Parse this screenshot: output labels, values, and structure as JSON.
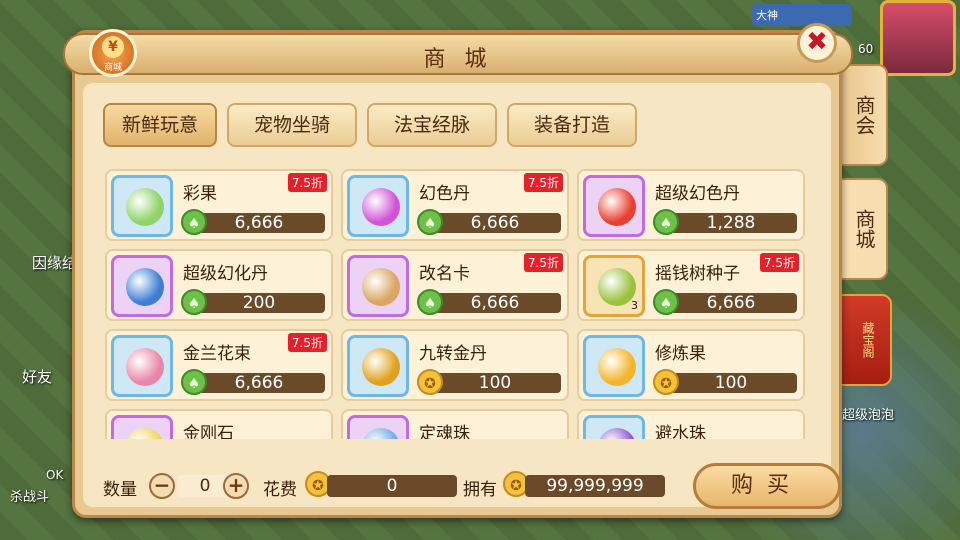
{
  "window": {
    "title": "商 城",
    "icon_label": "商城",
    "icon_symbol": "¥",
    "close_symbol": "✖"
  },
  "tabs": [
    {
      "label": "新鲜玩意",
      "active": true
    },
    {
      "label": "宠物坐骑",
      "active": false
    },
    {
      "label": "法宝经脉",
      "active": false
    },
    {
      "label": "装备打造",
      "active": false
    }
  ],
  "side_tabs": [
    {
      "label": "商会"
    },
    {
      "label": "商城"
    },
    {
      "label": "藏宝阁"
    }
  ],
  "items": [
    {
      "name": "彩果",
      "price": "6,666",
      "discount": "7.5折",
      "currency": "jade",
      "frame": "blue",
      "orb_color": "#8fd36a",
      "qty": ""
    },
    {
      "name": "幻色丹",
      "price": "6,666",
      "discount": "7.5折",
      "currency": "jade",
      "frame": "blue",
      "orb_color": "#d154d8",
      "qty": ""
    },
    {
      "name": "超级幻色丹",
      "price": "1,288",
      "discount": "",
      "currency": "jade",
      "frame": "purple",
      "orb_color": "#e8402e",
      "qty": ""
    },
    {
      "name": "超级幻化丹",
      "price": "200",
      "discount": "",
      "currency": "jade",
      "frame": "purple",
      "orb_color": "#3e7fd6",
      "qty": ""
    },
    {
      "name": "改名卡",
      "price": "6,666",
      "discount": "7.5折",
      "currency": "jade",
      "frame": "purple",
      "orb_color": "#d9a560",
      "qty": ""
    },
    {
      "name": "摇钱树种子",
      "price": "6,666",
      "discount": "7.5折",
      "currency": "jade",
      "frame": "orange",
      "orb_color": "#9bc23e",
      "qty": "3"
    },
    {
      "name": "金兰花束",
      "price": "6,666",
      "discount": "7.5折",
      "currency": "jade",
      "frame": "blue",
      "orb_color": "#e987a8",
      "qty": ""
    },
    {
      "name": "九转金丹",
      "price": "100",
      "discount": "",
      "currency": "gold",
      "frame": "blue",
      "orb_color": "#e0a21c",
      "qty": ""
    },
    {
      "name": "修炼果",
      "price": "100",
      "discount": "",
      "currency": "gold",
      "frame": "blue",
      "orb_color": "#f3b62a",
      "qty": ""
    },
    {
      "name": "金刚石",
      "price": "",
      "discount": "",
      "currency": "",
      "frame": "purple",
      "orb_color": "#f2d35c",
      "qty": ""
    },
    {
      "name": "定魂珠",
      "price": "",
      "discount": "",
      "currency": "",
      "frame": "purple",
      "orb_color": "#6aa8e8",
      "qty": ""
    },
    {
      "name": "避水珠",
      "price": "",
      "discount": "",
      "currency": "",
      "frame": "blue",
      "orb_color": "#8e5ad0",
      "qty": ""
    }
  ],
  "bottom": {
    "quantity_label": "数量",
    "quantity_value": "0",
    "minus": "−",
    "plus": "+",
    "cost_label": "花费",
    "cost_value": "0",
    "own_label": "拥有",
    "own_value": "99,999,999",
    "buy_label": "购买"
  },
  "currency_glyphs": {
    "jade": "♠",
    "gold": "✪"
  },
  "background_text": {
    "left1": "因缘结",
    "left2": "好友",
    "left3": "杀战斗",
    "left4": "OK",
    "right1": "超级泡泡",
    "hud_name": "大神",
    "hud_level": "60"
  }
}
